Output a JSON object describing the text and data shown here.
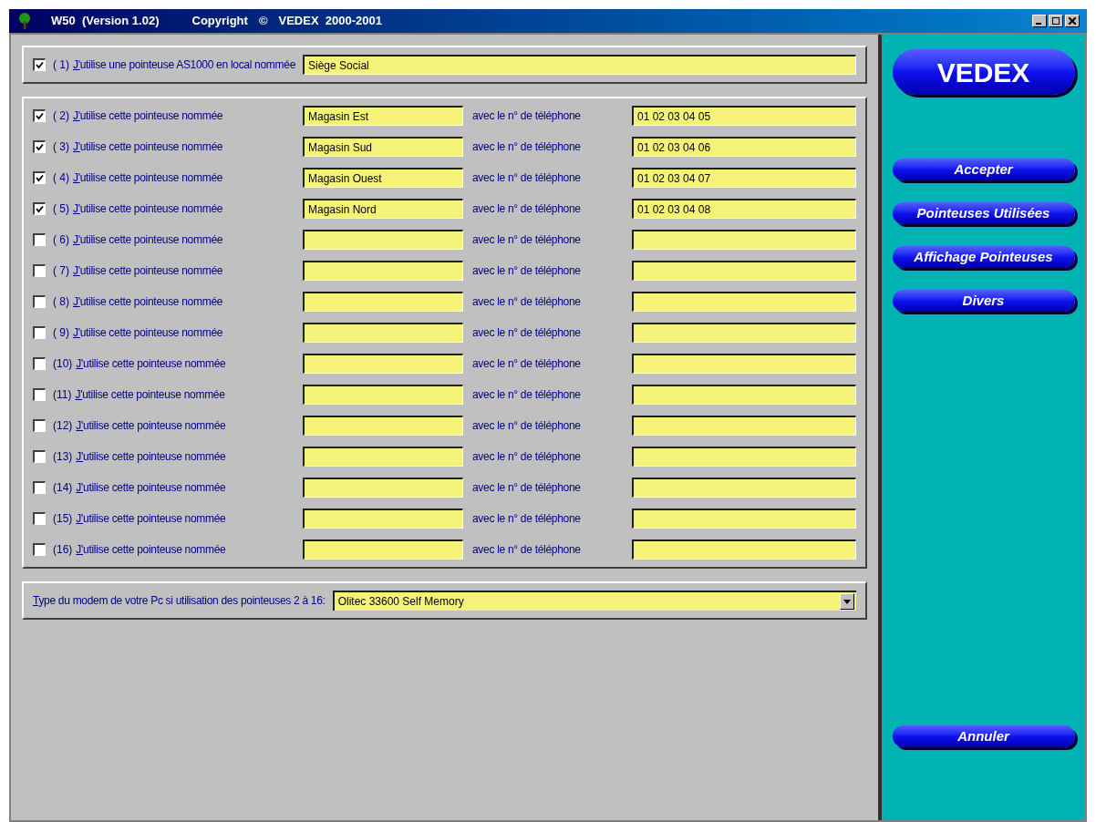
{
  "window": {
    "title_parts": [
      "W50  (Version 1.02)",
      "Copyright",
      "©",
      "VEDEX  2000-2001"
    ]
  },
  "local": {
    "checked": true,
    "number": "( 1)",
    "label": "J'utilise une pointeuse AS1000 en local nommée",
    "value": "Siège Social"
  },
  "remotes": [
    {
      "checked": true,
      "number": "( 2)",
      "label": "J'utilise cette pointeuse nommée",
      "name": "Magasin Est",
      "phone_label": "avec le n° de téléphone",
      "phone": "01 02 03 04 05"
    },
    {
      "checked": true,
      "number": "( 3)",
      "label": "J'utilise cette pointeuse nommée",
      "name": "Magasin Sud",
      "phone_label": "avec le n° de téléphone",
      "phone": "01 02 03 04 06"
    },
    {
      "checked": true,
      "number": "( 4)",
      "label": "J'utilise cette pointeuse nommée",
      "name": "Magasin Ouest",
      "phone_label": "avec le n° de téléphone",
      "phone": "01 02 03 04 07"
    },
    {
      "checked": true,
      "number": "( 5)",
      "label": "J'utilise cette pointeuse nommée",
      "name": "Magasin Nord",
      "phone_label": "avec le n° de téléphone",
      "phone": "01 02 03 04 08"
    },
    {
      "checked": false,
      "number": "( 6)",
      "label": "J'utilise cette pointeuse nommée",
      "phone_label": "avec le n° de téléphone"
    },
    {
      "checked": false,
      "number": "( 7)",
      "label": "J'utilise cette pointeuse nommée",
      "phone_label": "avec le n° de téléphone"
    },
    {
      "checked": false,
      "number": "( 8)",
      "label": "J'utilise cette pointeuse nommée",
      "phone_label": "avec le n° de téléphone"
    },
    {
      "checked": false,
      "number": "( 9)",
      "label": "J'utilise cette pointeuse nommée",
      "phone_label": "avec le n° de téléphone"
    },
    {
      "checked": false,
      "number": "(10)",
      "label": "J'utilise cette pointeuse nommée",
      "phone_label": "avec le n° de téléphone"
    },
    {
      "checked": false,
      "number": "(11)",
      "label": "J'utilise cette pointeuse nommée",
      "phone_label": "avec le n° de téléphone"
    },
    {
      "checked": false,
      "number": "(12)",
      "label": "J'utilise cette pointeuse nommée",
      "phone_label": "avec le n° de téléphone"
    },
    {
      "checked": false,
      "number": "(13)",
      "label": "J'utilise cette pointeuse nommée",
      "phone_label": "avec le n° de téléphone"
    },
    {
      "checked": false,
      "number": "(14)",
      "label": "J'utilise cette pointeuse nommée",
      "phone_label": "avec le n° de téléphone"
    },
    {
      "checked": false,
      "number": "(15)",
      "label": "J'utilise cette pointeuse nommée",
      "phone_label": "avec le n° de téléphone"
    },
    {
      "checked": false,
      "number": "(16)",
      "label": "J'utilise cette pointeuse nommée",
      "phone_label": "avec le n° de téléphone"
    }
  ],
  "modem": {
    "label": "Type du modem de votre Pc si utilisation des pointeuses 2 à 16:",
    "value": "Olitec 33600 Self Memory"
  },
  "sidebar": {
    "logo": "VEDEX",
    "buttons": [
      "Accepter",
      "Pointeuses Utilisées",
      "Affichage Pointeuses",
      "Divers"
    ],
    "cancel": "Annuler"
  }
}
